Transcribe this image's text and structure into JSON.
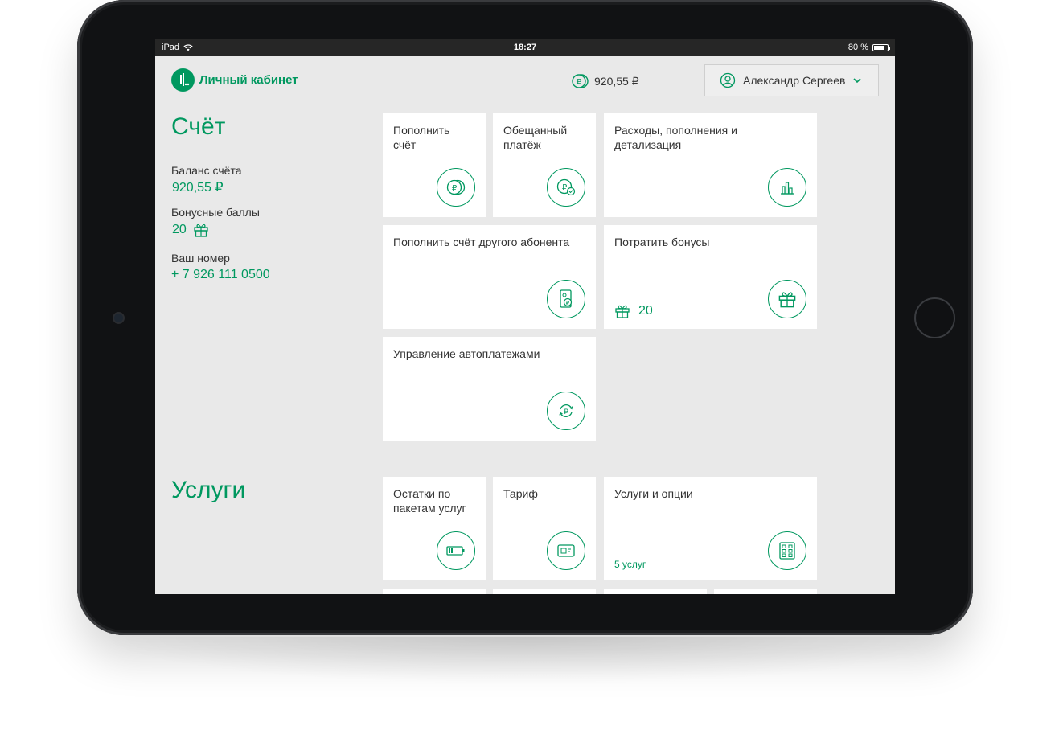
{
  "status_bar": {
    "device": "iPad",
    "time": "18:27",
    "battery": "80 %",
    "battery_level": 0.8
  },
  "header": {
    "app_title": "Личный кабинет",
    "balance": "920,55 ₽",
    "user_name": "Александр Сергеев"
  },
  "account": {
    "title": "Счёт",
    "balance_label": "Баланс счёта",
    "balance_value": "920,55 ₽",
    "bonus_label": "Бонусные баллы",
    "bonus_value": "20",
    "number_label": "Ваш номер",
    "number_value": "+ 7 926 111 0500"
  },
  "account_tiles": [
    {
      "label": "Пополнить счёт",
      "icon": "coin-ruble-icon"
    },
    {
      "label": "Обещанный платёж",
      "icon": "promised-payment-icon"
    },
    {
      "label": "Расходы, пополнения и детализация",
      "icon": "bar-chart-icon"
    },
    {
      "label": "Пополнить счёт другого абонента",
      "icon": "phone-ruble-icon"
    },
    {
      "label": "Потратить бонусы",
      "icon": "gift-icon",
      "bonus": "20"
    },
    {
      "label": "Управление автоплатежами",
      "icon": "autopay-icon"
    }
  ],
  "services": {
    "title": "Услуги",
    "tiles": [
      {
        "label": "Остатки по пакетам услуг",
        "icon": "battery-icon"
      },
      {
        "label": "Тариф",
        "icon": "sim-card-icon"
      },
      {
        "label": "Услуги и опции",
        "icon": "options-grid-icon",
        "sub": "5 услуг"
      }
    ]
  },
  "colors": {
    "accent": "#00985f",
    "background": "#e9e9e9",
    "tile": "#ffffff",
    "text": "#333333"
  }
}
